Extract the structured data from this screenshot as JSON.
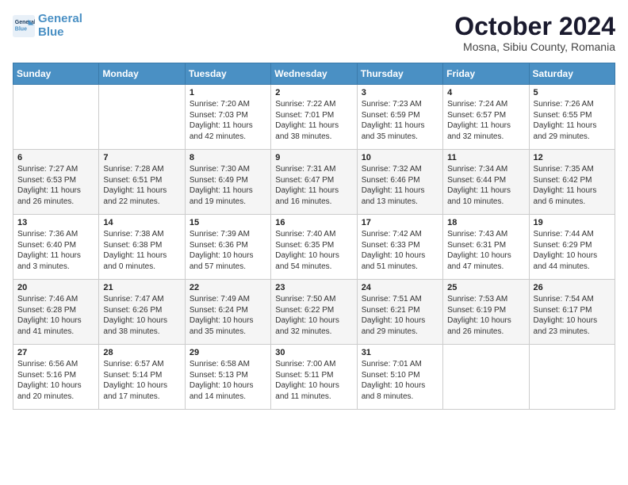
{
  "header": {
    "logo_line1": "General",
    "logo_line2": "Blue",
    "month": "October 2024",
    "location": "Mosna, Sibiu County, Romania"
  },
  "days_of_week": [
    "Sunday",
    "Monday",
    "Tuesday",
    "Wednesday",
    "Thursday",
    "Friday",
    "Saturday"
  ],
  "weeks": [
    [
      {
        "day": "",
        "text": ""
      },
      {
        "day": "",
        "text": ""
      },
      {
        "day": "1",
        "text": "Sunrise: 7:20 AM\nSunset: 7:03 PM\nDaylight: 11 hours and 42 minutes."
      },
      {
        "day": "2",
        "text": "Sunrise: 7:22 AM\nSunset: 7:01 PM\nDaylight: 11 hours and 38 minutes."
      },
      {
        "day": "3",
        "text": "Sunrise: 7:23 AM\nSunset: 6:59 PM\nDaylight: 11 hours and 35 minutes."
      },
      {
        "day": "4",
        "text": "Sunrise: 7:24 AM\nSunset: 6:57 PM\nDaylight: 11 hours and 32 minutes."
      },
      {
        "day": "5",
        "text": "Sunrise: 7:26 AM\nSunset: 6:55 PM\nDaylight: 11 hours and 29 minutes."
      }
    ],
    [
      {
        "day": "6",
        "text": "Sunrise: 7:27 AM\nSunset: 6:53 PM\nDaylight: 11 hours and 26 minutes."
      },
      {
        "day": "7",
        "text": "Sunrise: 7:28 AM\nSunset: 6:51 PM\nDaylight: 11 hours and 22 minutes."
      },
      {
        "day": "8",
        "text": "Sunrise: 7:30 AM\nSunset: 6:49 PM\nDaylight: 11 hours and 19 minutes."
      },
      {
        "day": "9",
        "text": "Sunrise: 7:31 AM\nSunset: 6:47 PM\nDaylight: 11 hours and 16 minutes."
      },
      {
        "day": "10",
        "text": "Sunrise: 7:32 AM\nSunset: 6:46 PM\nDaylight: 11 hours and 13 minutes."
      },
      {
        "day": "11",
        "text": "Sunrise: 7:34 AM\nSunset: 6:44 PM\nDaylight: 11 hours and 10 minutes."
      },
      {
        "day": "12",
        "text": "Sunrise: 7:35 AM\nSunset: 6:42 PM\nDaylight: 11 hours and 6 minutes."
      }
    ],
    [
      {
        "day": "13",
        "text": "Sunrise: 7:36 AM\nSunset: 6:40 PM\nDaylight: 11 hours and 3 minutes."
      },
      {
        "day": "14",
        "text": "Sunrise: 7:38 AM\nSunset: 6:38 PM\nDaylight: 11 hours and 0 minutes."
      },
      {
        "day": "15",
        "text": "Sunrise: 7:39 AM\nSunset: 6:36 PM\nDaylight: 10 hours and 57 minutes."
      },
      {
        "day": "16",
        "text": "Sunrise: 7:40 AM\nSunset: 6:35 PM\nDaylight: 10 hours and 54 minutes."
      },
      {
        "day": "17",
        "text": "Sunrise: 7:42 AM\nSunset: 6:33 PM\nDaylight: 10 hours and 51 minutes."
      },
      {
        "day": "18",
        "text": "Sunrise: 7:43 AM\nSunset: 6:31 PM\nDaylight: 10 hours and 47 minutes."
      },
      {
        "day": "19",
        "text": "Sunrise: 7:44 AM\nSunset: 6:29 PM\nDaylight: 10 hours and 44 minutes."
      }
    ],
    [
      {
        "day": "20",
        "text": "Sunrise: 7:46 AM\nSunset: 6:28 PM\nDaylight: 10 hours and 41 minutes."
      },
      {
        "day": "21",
        "text": "Sunrise: 7:47 AM\nSunset: 6:26 PM\nDaylight: 10 hours and 38 minutes."
      },
      {
        "day": "22",
        "text": "Sunrise: 7:49 AM\nSunset: 6:24 PM\nDaylight: 10 hours and 35 minutes."
      },
      {
        "day": "23",
        "text": "Sunrise: 7:50 AM\nSunset: 6:22 PM\nDaylight: 10 hours and 32 minutes."
      },
      {
        "day": "24",
        "text": "Sunrise: 7:51 AM\nSunset: 6:21 PM\nDaylight: 10 hours and 29 minutes."
      },
      {
        "day": "25",
        "text": "Sunrise: 7:53 AM\nSunset: 6:19 PM\nDaylight: 10 hours and 26 minutes."
      },
      {
        "day": "26",
        "text": "Sunrise: 7:54 AM\nSunset: 6:17 PM\nDaylight: 10 hours and 23 minutes."
      }
    ],
    [
      {
        "day": "27",
        "text": "Sunrise: 6:56 AM\nSunset: 5:16 PM\nDaylight: 10 hours and 20 minutes."
      },
      {
        "day": "28",
        "text": "Sunrise: 6:57 AM\nSunset: 5:14 PM\nDaylight: 10 hours and 17 minutes."
      },
      {
        "day": "29",
        "text": "Sunrise: 6:58 AM\nSunset: 5:13 PM\nDaylight: 10 hours and 14 minutes."
      },
      {
        "day": "30",
        "text": "Sunrise: 7:00 AM\nSunset: 5:11 PM\nDaylight: 10 hours and 11 minutes."
      },
      {
        "day": "31",
        "text": "Sunrise: 7:01 AM\nSunset: 5:10 PM\nDaylight: 10 hours and 8 minutes."
      },
      {
        "day": "",
        "text": ""
      },
      {
        "day": "",
        "text": ""
      }
    ]
  ]
}
